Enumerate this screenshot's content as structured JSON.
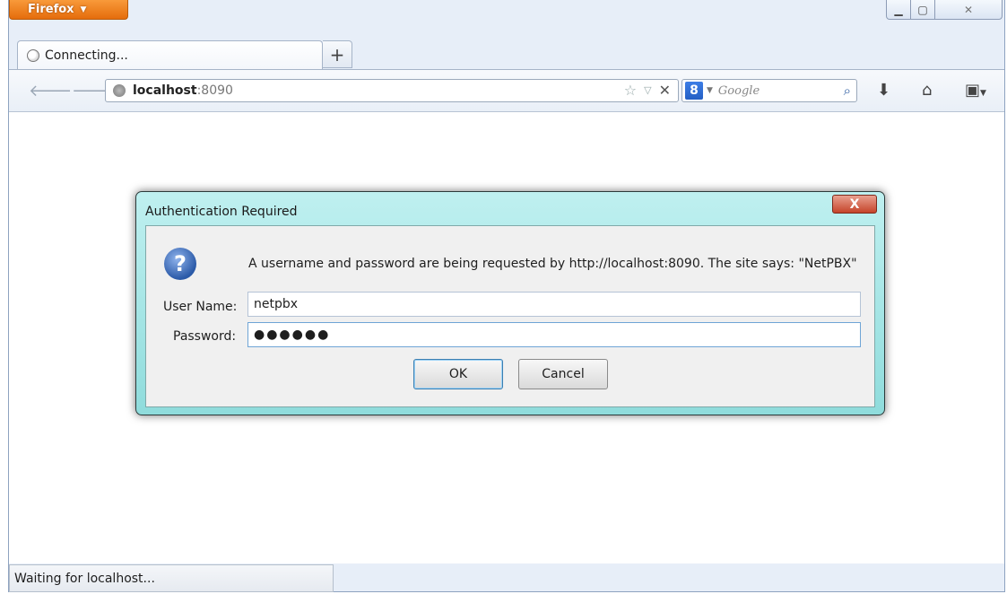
{
  "app": {
    "menu_label": "Firefox"
  },
  "tab": {
    "title": "Connecting...",
    "new_tab": "+"
  },
  "url": {
    "host": "localhost",
    "port": ":8090"
  },
  "search": {
    "engine_badge": "8",
    "placeholder": "Google"
  },
  "status": {
    "text": "Waiting for localhost..."
  },
  "dialog": {
    "title": "Authentication Required",
    "close_label": "X",
    "message": "A username and password are being requested by http://localhost:8090. The site says: \"NetPBX\"",
    "username_label": "User Name:",
    "username_value": "netpbx",
    "password_label": "Password:",
    "password_masked": "●●●●●●",
    "ok_label": "OK",
    "cancel_label": "Cancel"
  },
  "icons": {
    "back": "back-arrow-icon",
    "forward": "forward-arrow-icon",
    "bookmark": "star-icon",
    "download": "download-arrow-icon",
    "home": "home-icon",
    "bookmarks_menu": "bookmarks-menu-icon",
    "question": "question-icon"
  },
  "colors": {
    "firefox_orange": "#e56d0c",
    "dialog_frame": "#8fdcdc",
    "close_red": "#c5442a"
  }
}
